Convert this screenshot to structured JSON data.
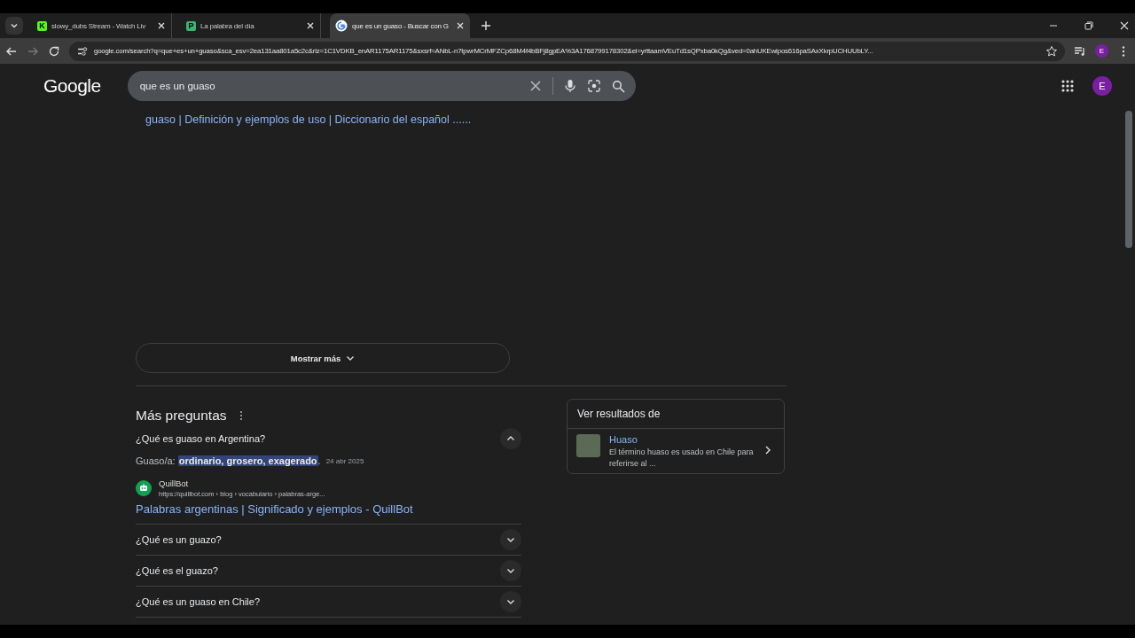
{
  "tabs": [
    {
      "title": "slowy_dubs Stream - Watch Liv",
      "kind": "letter",
      "letter": "K",
      "color": "#53fc18",
      "selected": false
    },
    {
      "title": "La palabra del día",
      "kind": "letter",
      "letter": "P",
      "color": "#3cb371",
      "selected": false
    },
    {
      "title": "que es un guaso - Buscar con G",
      "kind": "google",
      "selected": true
    }
  ],
  "address_bar": {
    "url": "google.com/search?q=que+es+un+guaso&sca_esv=2ea131aa801a5c2c&rlz=1C1VDKB_enAR1175AR1175&sxsrf=ANbL-n7tpwrMCrMFZCp68M4f4bBFj8gpEA%3A1768799178302&ei=yrttaamVEuTd1sQPxba0kQg&ved=0ahUKEwipos616paSAxXkrpUCHUUbLY...",
    "profile_initial": "E"
  },
  "header": {
    "logo": "Google",
    "search_value": "que es un guaso",
    "profile_initial": "E"
  },
  "result_link": "guaso | Definición y ejemplos de uso | Diccionario del español ......",
  "show_more": "Mostrar más",
  "more_questions": {
    "title": "Más preguntas",
    "items": [
      {
        "question": "¿Qué es guaso en Argentina?",
        "expanded": true,
        "answer_prefix": "Guaso/a: ",
        "answer_highlight": "ordinario, grosero, exagerado",
        "answer_suffix": ".",
        "date": "24 abr 2025",
        "source_name": "QuillBot",
        "source_url": "https://quillbot.com › blog › vocabulario › palabras-arge...",
        "source_title": "Palabras argentinas | Significado y ejemplos - QuillBot"
      },
      {
        "question": "¿Qué es un guazo?",
        "expanded": false
      },
      {
        "question": "¿Qué es el guazo?",
        "expanded": false
      },
      {
        "question": "¿Qué es un guaso en Chile?",
        "expanded": false
      }
    ]
  },
  "see_results": {
    "title": "Ver resultados de",
    "items": [
      {
        "name": "Huaso",
        "description": "El término huaso  es usado en Chile para referirse al ..."
      }
    ]
  }
}
